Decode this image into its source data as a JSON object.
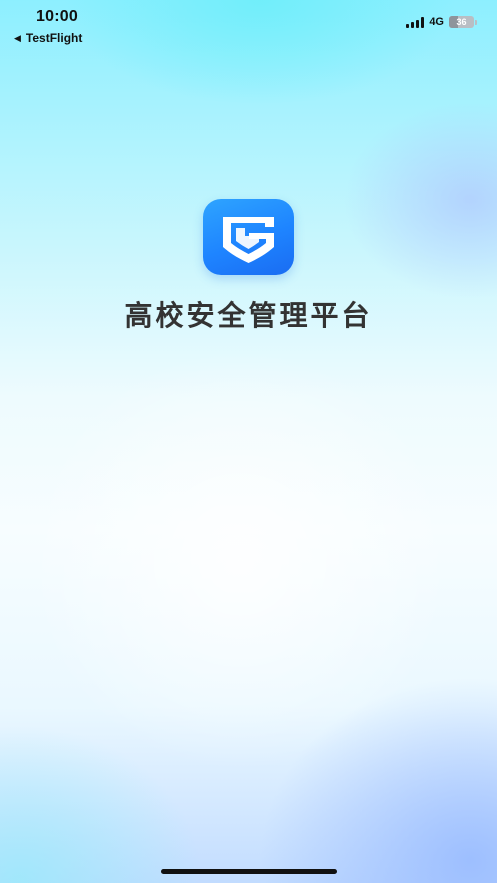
{
  "status_bar": {
    "time": "10:00",
    "back_label": "TestFlight",
    "network": "4G",
    "battery_level": "36",
    "battery_fraction": 0.36
  },
  "app": {
    "title": "高校安全管理平台",
    "logo_icon": "shield-book-logo-icon"
  },
  "colors": {
    "logo_blue": "#1e84ff",
    "title": "#333333"
  }
}
